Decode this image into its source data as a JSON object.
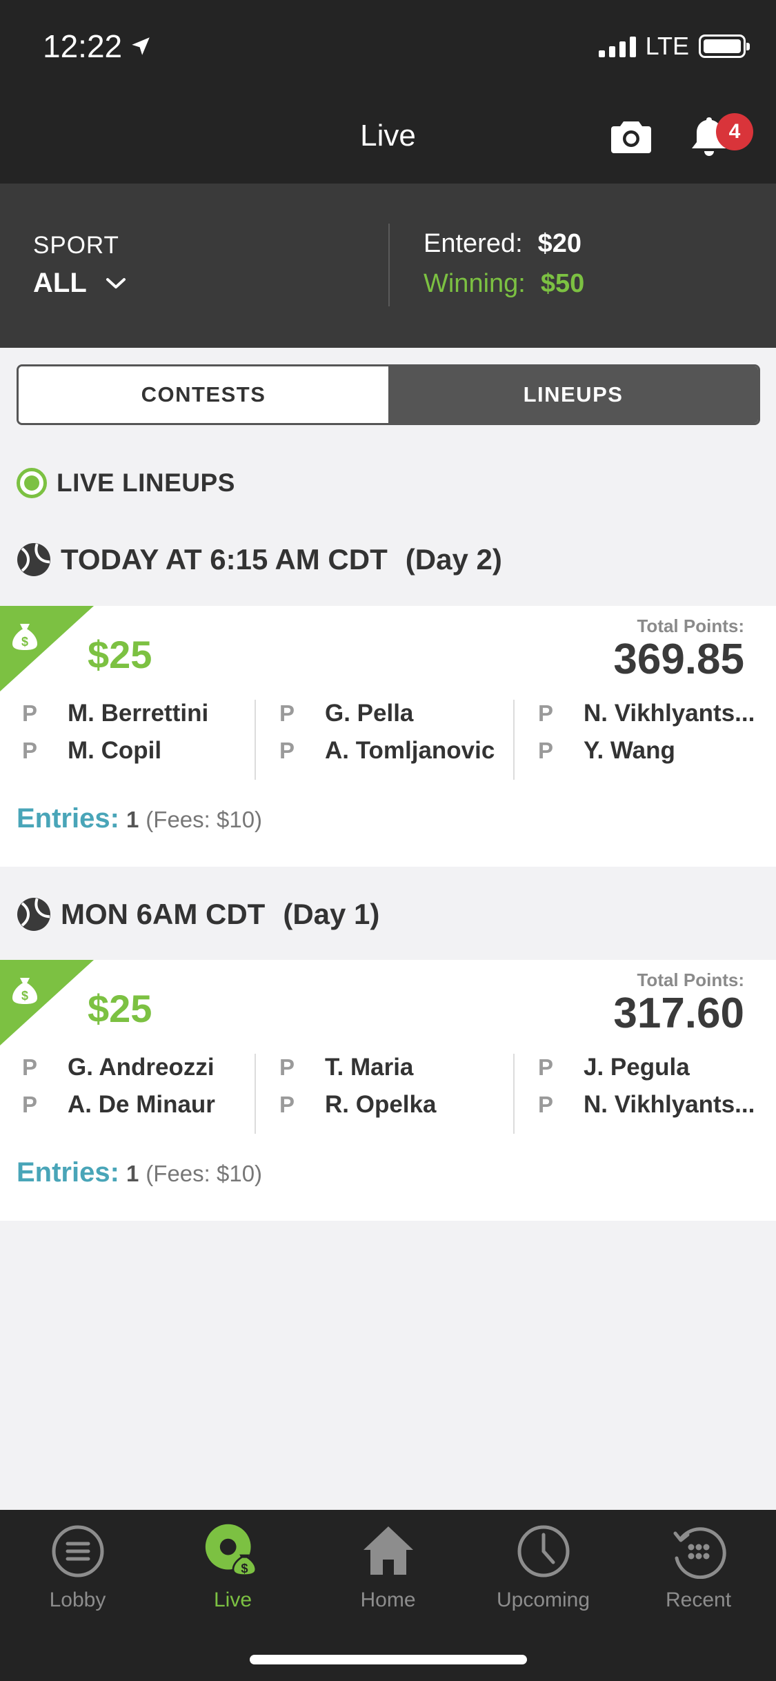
{
  "status": {
    "time": "12:22",
    "network": "LTE"
  },
  "header": {
    "title": "Live",
    "notification_count": "4"
  },
  "sport_panel": {
    "sport_label": "SPORT",
    "sport_value": "ALL",
    "entered_label": "Entered:",
    "entered_value": "$20",
    "winning_label": "Winning:",
    "winning_value": "$50"
  },
  "segment": {
    "contests": "CONTESTS",
    "lineups": "LINEUPS",
    "selected": "LINEUPS"
  },
  "section_title": "LIVE LINEUPS",
  "groups": [
    {
      "title": "TODAY AT 6:15 AM CDT",
      "day": "(Day 2)",
      "prize": "$25",
      "total_points_label": "Total Points:",
      "total_points": "369.85",
      "players": [
        [
          {
            "pos": "P",
            "name": "M. Berrettini"
          },
          {
            "pos": "P",
            "name": "M. Copil"
          }
        ],
        [
          {
            "pos": "P",
            "name": "G. Pella"
          },
          {
            "pos": "P",
            "name": "A. Tomljanovic"
          }
        ],
        [
          {
            "pos": "P",
            "name": "N. Vikhlyants..."
          },
          {
            "pos": "P",
            "name": "Y. Wang"
          }
        ]
      ],
      "entries_label": "Entries:",
      "entries_count": "1",
      "fees": "(Fees: $10)"
    },
    {
      "title": "MON 6AM CDT",
      "day": "(Day 1)",
      "prize": "$25",
      "total_points_label": "Total Points:",
      "total_points": "317.60",
      "players": [
        [
          {
            "pos": "P",
            "name": "G. Andreozzi"
          },
          {
            "pos": "P",
            "name": "A. De Minaur"
          }
        ],
        [
          {
            "pos": "P",
            "name": "T. Maria"
          },
          {
            "pos": "P",
            "name": "R. Opelka"
          }
        ],
        [
          {
            "pos": "P",
            "name": "J. Pegula"
          },
          {
            "pos": "P",
            "name": "N. Vikhlyants..."
          }
        ]
      ],
      "entries_label": "Entries:",
      "entries_count": "1",
      "fees": "(Fees: $10)"
    }
  ],
  "tabbar": {
    "items": [
      {
        "label": "Lobby",
        "icon": "lobby-icon"
      },
      {
        "label": "Live",
        "icon": "live-icon",
        "active": true
      },
      {
        "label": "Home",
        "icon": "home-icon"
      },
      {
        "label": "Upcoming",
        "icon": "clock-icon"
      },
      {
        "label": "Recent",
        "icon": "recent-icon"
      }
    ]
  },
  "colors": {
    "accent_green": "#7cc142",
    "entries_blue": "#49a5b8",
    "badge_red": "#d9343a",
    "header_bg": "#242424"
  }
}
